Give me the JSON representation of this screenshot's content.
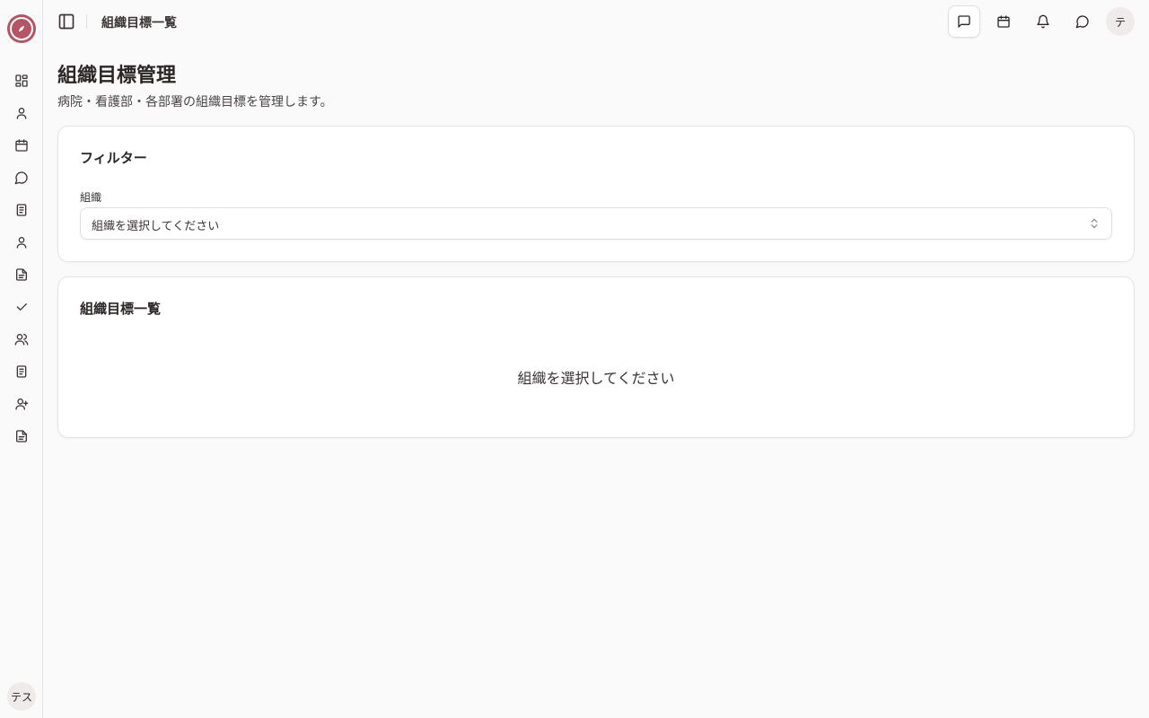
{
  "header": {
    "title": "組織目標一覧",
    "user_initial": "テ"
  },
  "sidebar": {
    "user_label": "テス",
    "items": [
      {
        "icon": "dashboard-icon"
      },
      {
        "icon": "user-icon"
      },
      {
        "icon": "calendar-icon"
      },
      {
        "icon": "message-icon"
      },
      {
        "icon": "notebook-icon"
      },
      {
        "icon": "user-icon"
      },
      {
        "icon": "document-icon"
      },
      {
        "icon": "check-icon"
      },
      {
        "icon": "users-icon"
      },
      {
        "icon": "notebook-icon"
      },
      {
        "icon": "user-plus-icon"
      },
      {
        "icon": "document-icon"
      }
    ]
  },
  "page": {
    "title": "組織目標管理",
    "description": "病院・看護部・各部署の組織目標を管理します。"
  },
  "filter": {
    "title": "フィルター",
    "org_label": "組織",
    "org_placeholder": "組織を選択してください"
  },
  "list": {
    "title": "組織目標一覧",
    "empty_message": "組織を選択してください"
  },
  "colors": {
    "brand": "#b45565",
    "background": "#fbfafa"
  }
}
